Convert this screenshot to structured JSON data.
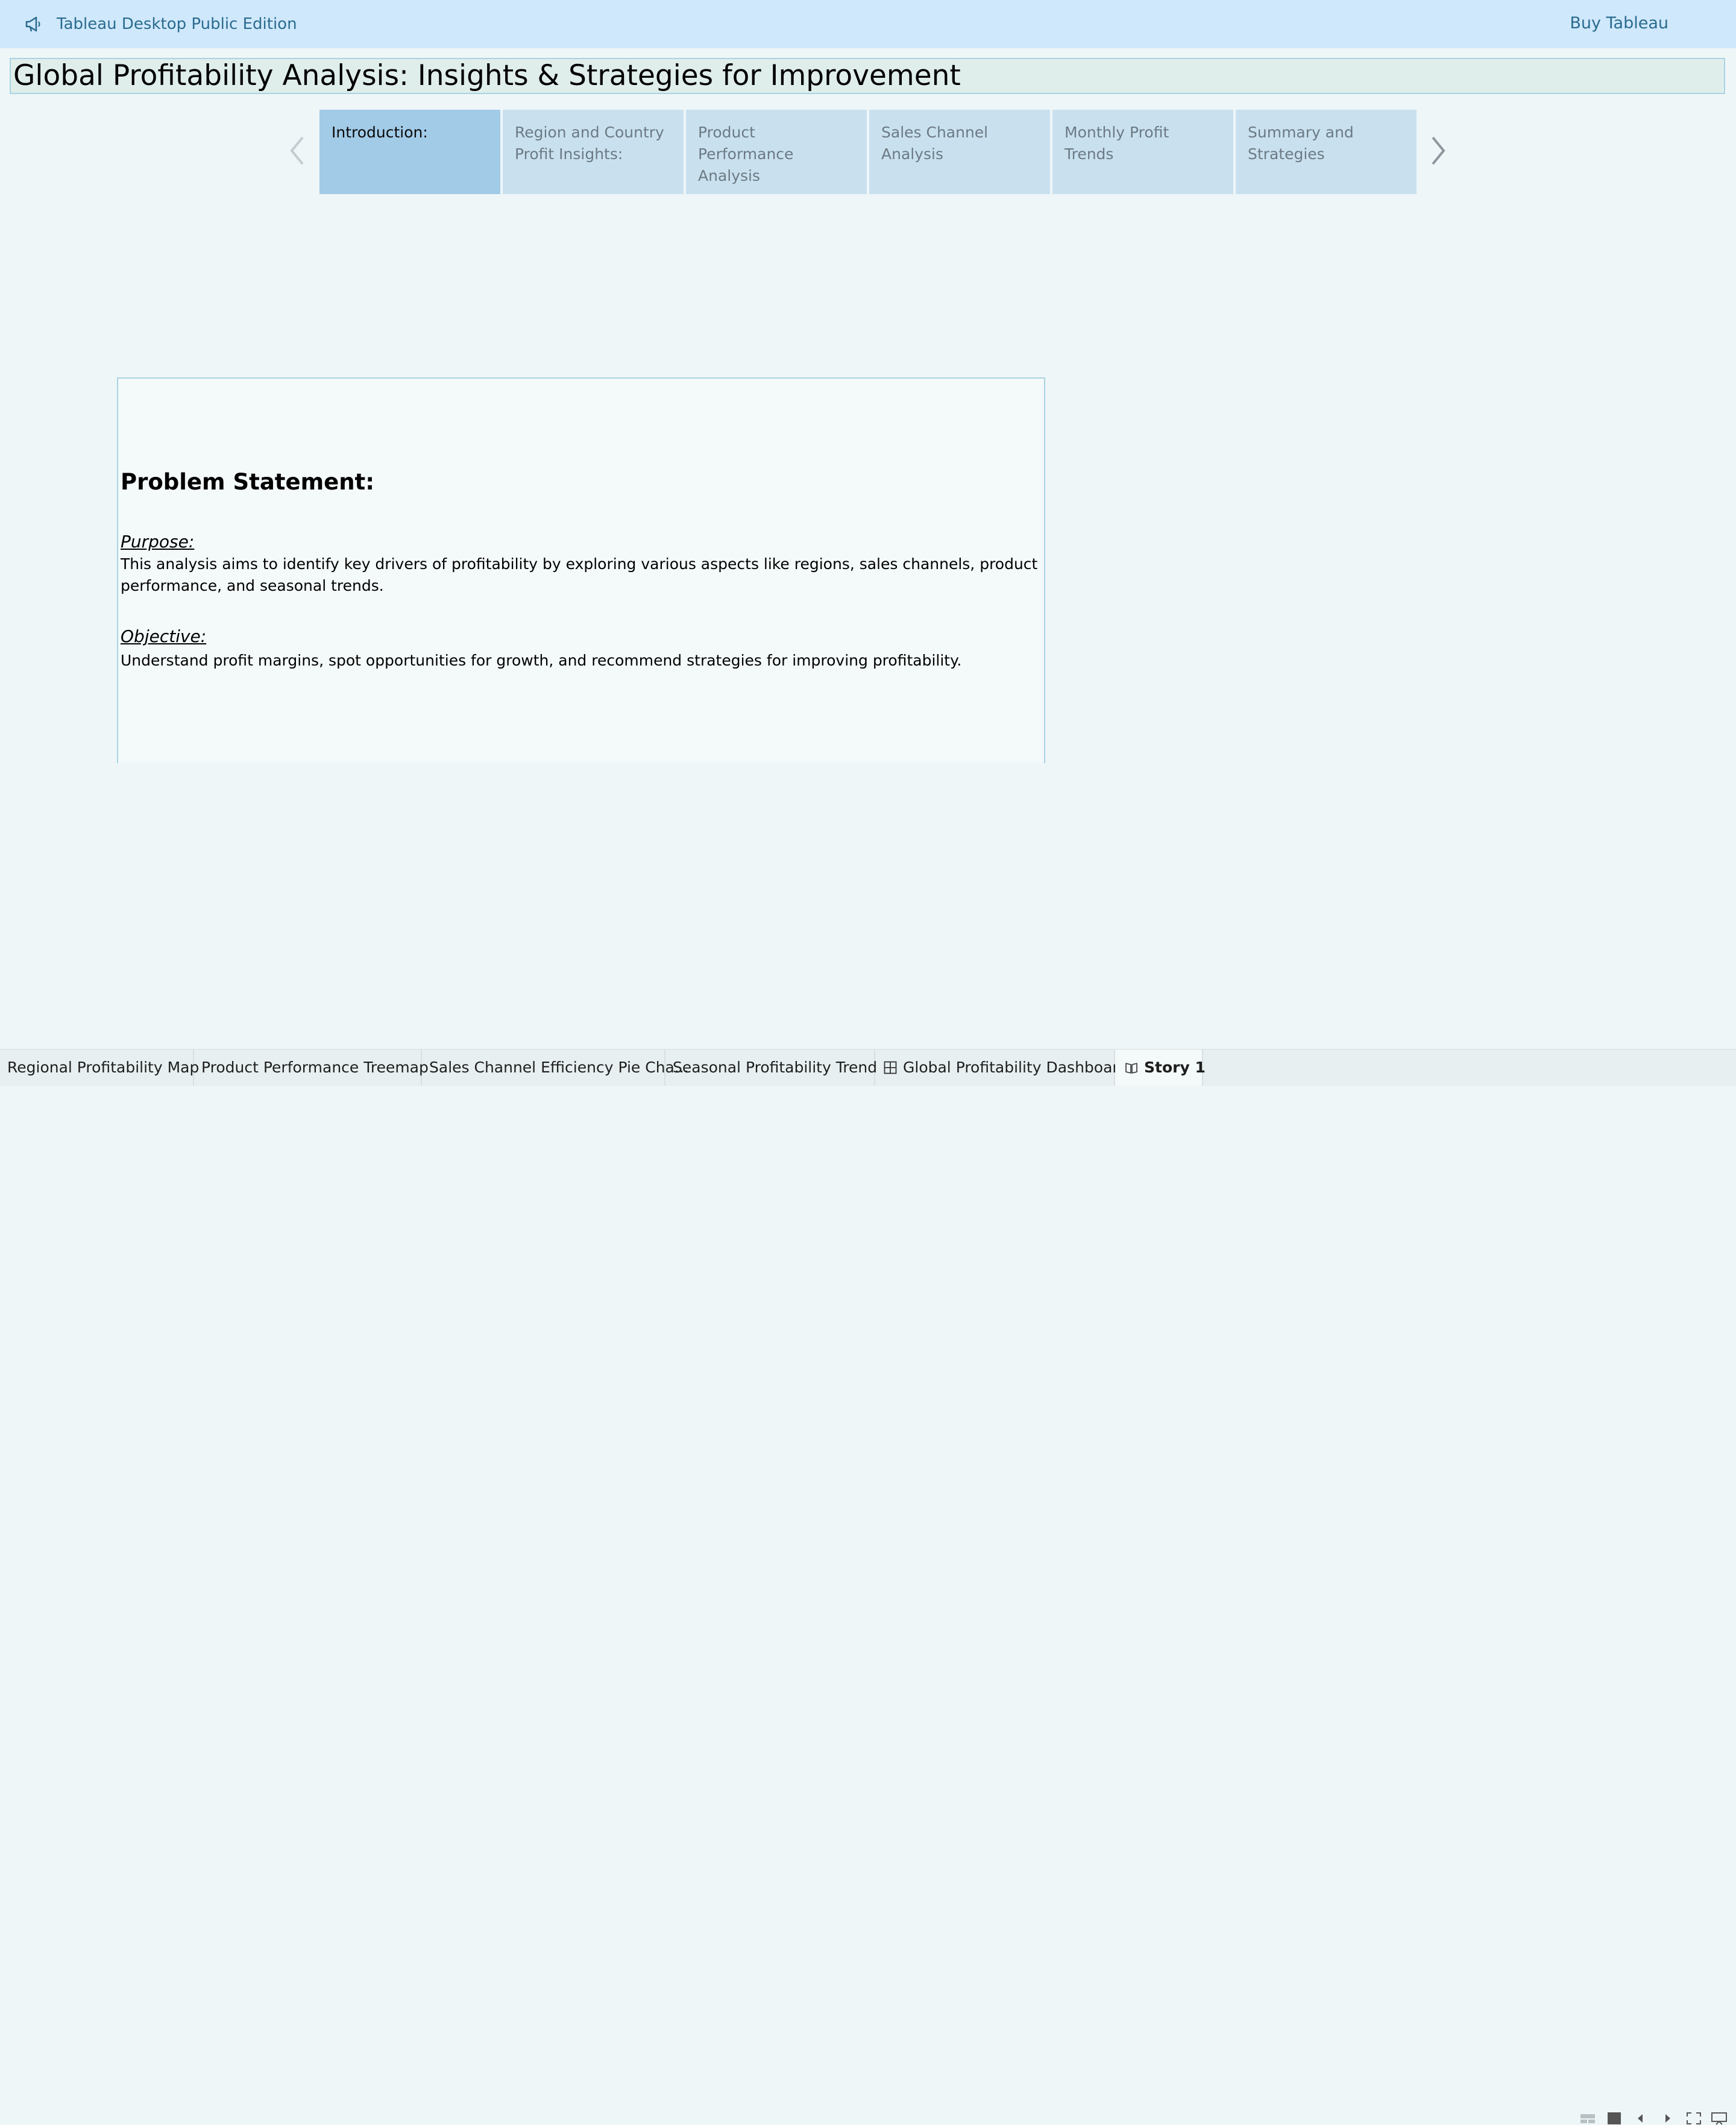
{
  "topbar": {
    "edition_label": "Tableau Desktop Public Edition",
    "buy_label": "Buy Tableau",
    "icon": "megaphone-icon"
  },
  "story": {
    "title": "Global Profitability Analysis: Insights & Strategies for Improvement",
    "points": [
      {
        "label": "Introduction:",
        "active": true
      },
      {
        "label": "Region and Country Profit Insights:",
        "active": false
      },
      {
        "label": "Product Performance Analysis",
        "active": false
      },
      {
        "label": "Sales Channel Analysis",
        "active": false
      },
      {
        "label": "Monthly Profit Trends",
        "active": false
      },
      {
        "label": "Summary and Strategies",
        "active": false
      }
    ],
    "prev_icon": "chevron-left-icon",
    "next_icon": "chevron-right-icon"
  },
  "content": {
    "heading": "Problem Statement:",
    "purpose_label": "Purpose:",
    "purpose_text": "This analysis aims to identify key drivers of profitability by exploring various aspects like regions, sales channels, product performance, and seasonal trends.",
    "objective_label": "Objective:",
    "objective_text": "Understand profit margins, spot opportunities for growth, and recommend strategies for improving profitability."
  },
  "tabs": [
    {
      "label": "Regional Profitability Map",
      "icon": null,
      "active": false
    },
    {
      "label": "Product Performance Treemap",
      "icon": null,
      "active": false
    },
    {
      "label": "Sales Channel Efficiency Pie Cha...",
      "icon": null,
      "active": false
    },
    {
      "label": "Seasonal Profitability Trend",
      "icon": null,
      "active": false
    },
    {
      "label": "Global Profitability Dashboard",
      "icon": "dashboard-grid-icon",
      "active": false
    },
    {
      "label": "Story 1",
      "icon": "story-book-icon",
      "active": true
    }
  ],
  "controls": [
    "sheet-sorter-icon",
    "normal-view-icon",
    "previous-sheet-icon",
    "next-sheet-icon",
    "fullscreen-icon",
    "presentation-mode-icon"
  ],
  "colors": {
    "topbar_bg": "#cfe8fb",
    "page_bg": "#eff6f8",
    "active_point_bg": "#a2cbe8",
    "inactive_point_bg": "#c9e1ef",
    "link_color": "#2a6b8f"
  }
}
